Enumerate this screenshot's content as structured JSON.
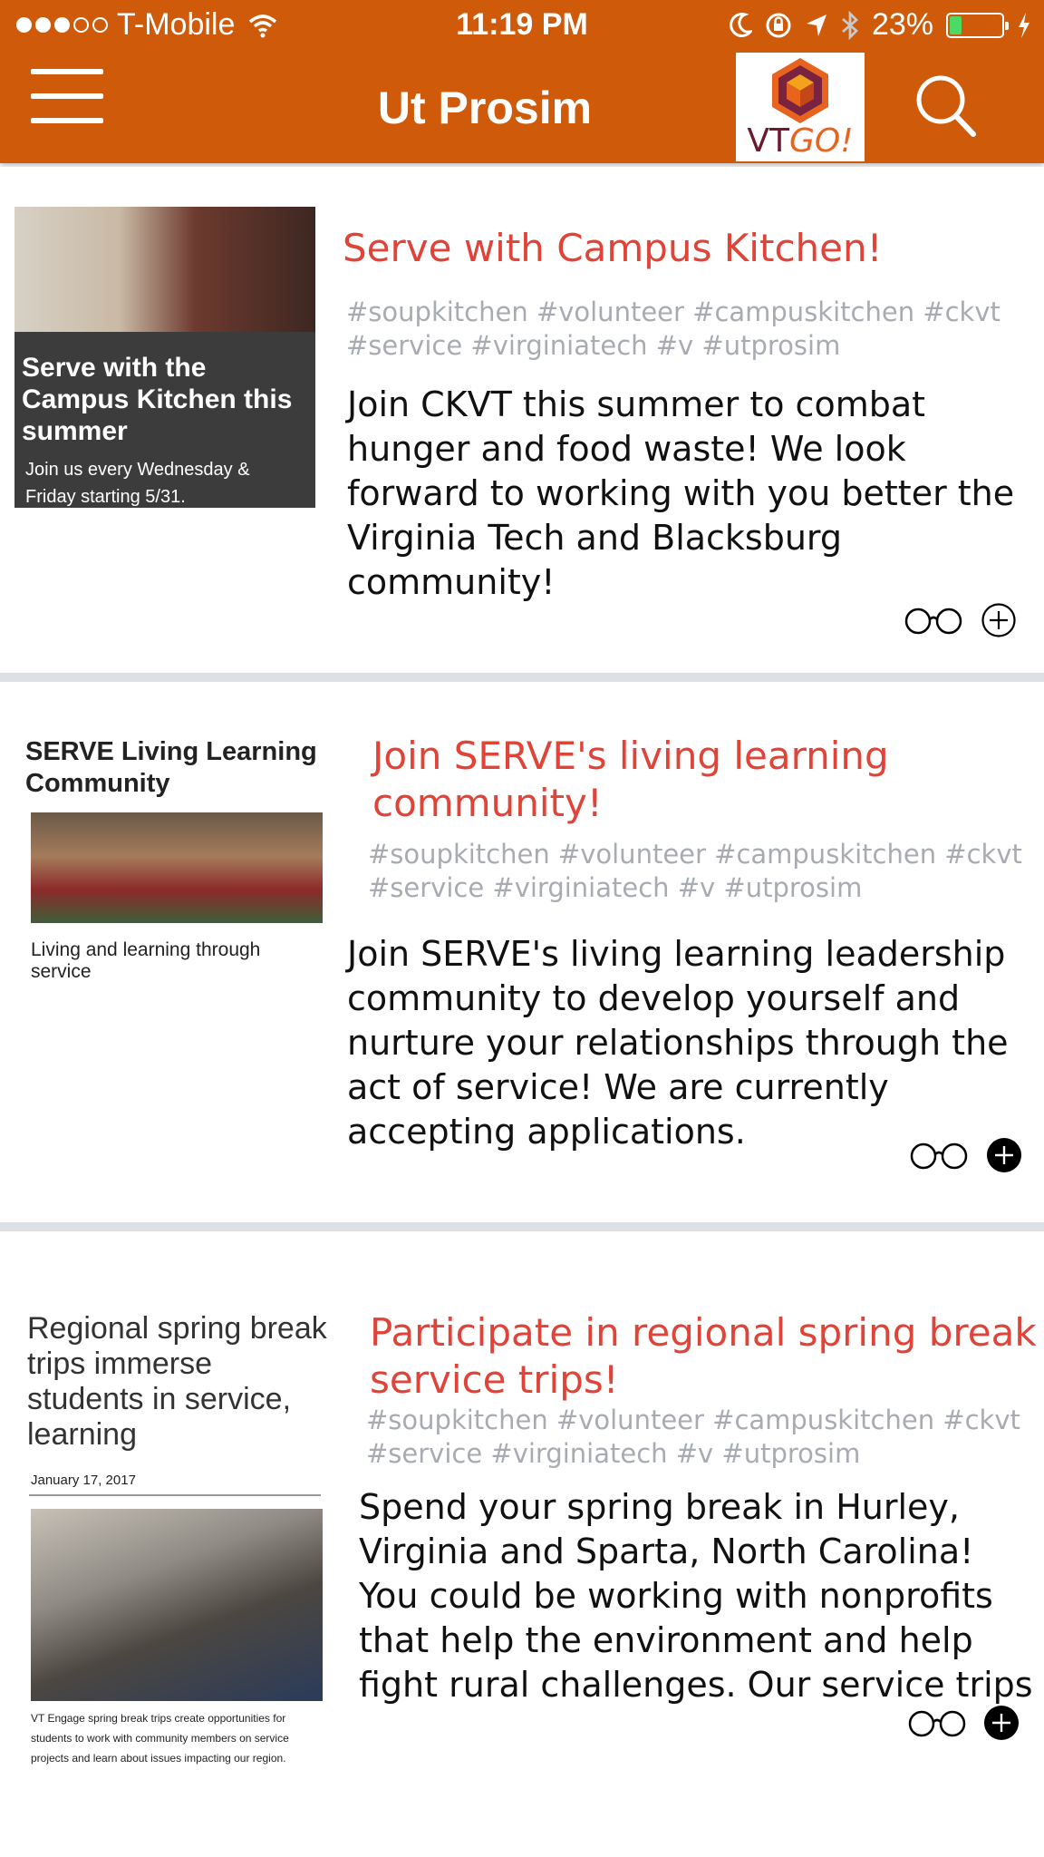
{
  "status_bar": {
    "carrier": "T-Mobile",
    "time": "11:19 PM",
    "battery": "23%",
    "battery_level": 0.23,
    "signal_bars_full": 3,
    "signal_bars_total": 5
  },
  "header": {
    "title": "Ut Prosim",
    "logo_text_vt": "VT",
    "logo_text_go": "GO!",
    "brand_color": "#cf5a0a",
    "accent_red": "#e04338"
  },
  "items": [
    {
      "title": "Serve with Campus Kitchen!",
      "tags_line1": "#soupkitchen #volunteer #campuskitchen #ckvt",
      "tags_line2": "#service #virginiatech #v #utprosim",
      "desc_lines": [
        "Join CKVT this summer to combat",
        "hunger and food waste! We look",
        "forward to working with you better the",
        "Virginia Tech and Blacksburg",
        "community!"
      ],
      "thumb_heading": "Serve with the Campus Kitchen this summer",
      "thumb_sub_line1": "Join us every Wednesday &",
      "thumb_sub_line2": "Friday starting 5/31.",
      "added": false
    },
    {
      "title_line1": "Join SERVE's living learning",
      "title_line2": "community!",
      "tags_line1": "#soupkitchen #volunteer #campuskitchen #ckvt",
      "tags_line2": "#service #virginiatech #v #utprosim",
      "desc_lines": [
        "Join SERVE's living learning leadership",
        "community to develop yourself and",
        "nurture your relationships through the",
        "act of service! We are currently",
        "accepting applications."
      ],
      "thumb_heading_line1": "SERVE Living Learning",
      "thumb_heading_line2": "Community",
      "thumb_sub_line1": "Living and learning through",
      "thumb_sub_line2": "service",
      "added": true
    },
    {
      "title_line1": "Participate in regional spring break",
      "title_line2": "service trips!",
      "tags_line1": "#soupkitchen #volunteer #campuskitchen #ckvt",
      "tags_line2": "#service #virginiatech #v #utprosim",
      "desc_lines": [
        "Spend your spring break in Hurley,",
        "Virginia and Sparta, North Carolina!",
        "You could be working with nonprofits",
        "that help the environment and help",
        "fight rural challenges. Our service trips"
      ],
      "thumb_heading_lines": [
        "Regional spring break",
        "trips immerse",
        "students in service,",
        "learning"
      ],
      "thumb_date": "January 17, 2017",
      "thumb_caption_lines": [
        "VT Engage spring break trips create opportunities for",
        "students to work with community members on service",
        "projects and learn about issues impacting our region."
      ],
      "added": true
    }
  ]
}
